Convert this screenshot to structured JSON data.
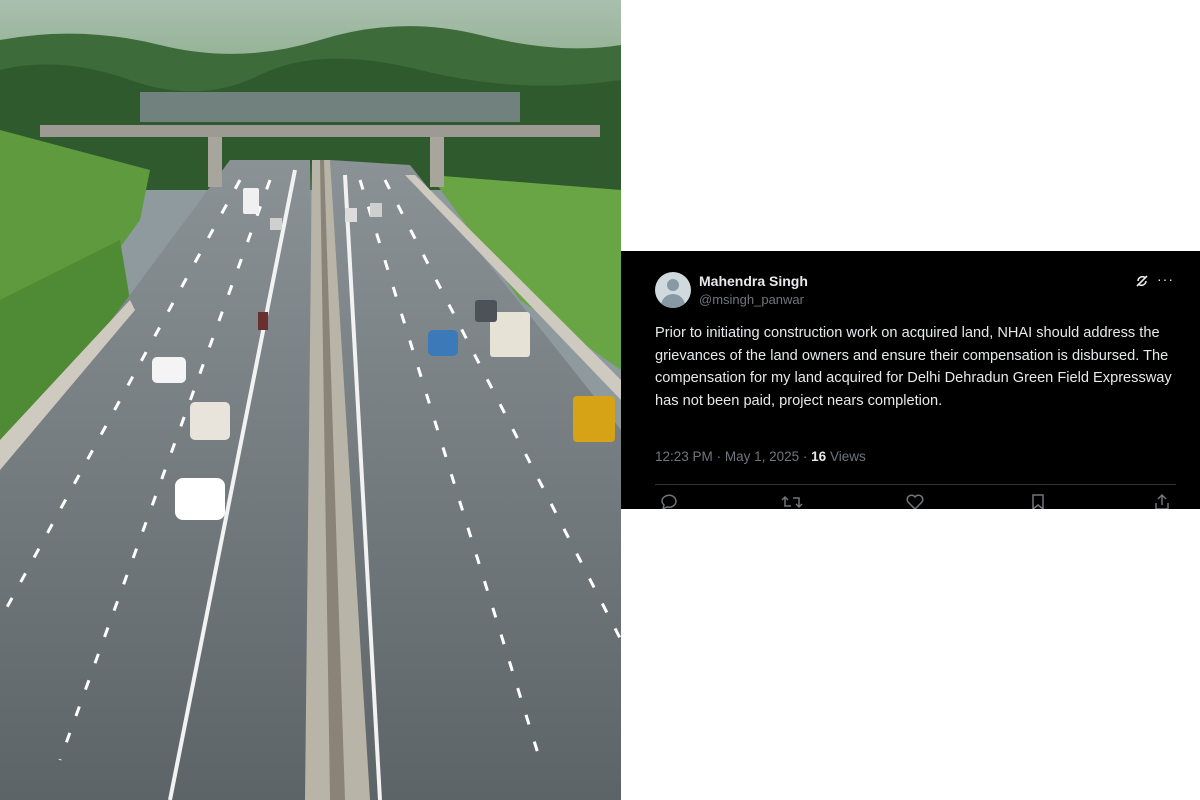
{
  "photo": {
    "description_icon": "highway-photo",
    "colors": {
      "sky": "#9fb6a0",
      "road": "#6b7377",
      "grass": "#5f9a3e",
      "trees": "#2f5a2e"
    }
  },
  "tweet": {
    "author_name": "Mahendra Singh",
    "author_handle": "@msingh_panwar",
    "body": "Prior to initiating construction work on acquired land, NHAI should address the grievances of the land owners and ensure their compensation is disbursed. The compensation for my land acquired for Delhi Dehradun Green Field Expressway has not been paid, project nears completion.",
    "time": "12:23 PM",
    "date": "May 1, 2025",
    "separator": "·",
    "views_count": "16",
    "views_label": "Views",
    "more_label": "···",
    "icons": [
      "grok-icon",
      "reply-icon",
      "retweet-icon",
      "like-icon",
      "bookmark-icon",
      "share-icon"
    ]
  },
  "colors": {
    "card_bg": "#000000",
    "primary_text": "#e7e9ea",
    "secondary_text": "#71767b",
    "divider": "#2f3336"
  }
}
